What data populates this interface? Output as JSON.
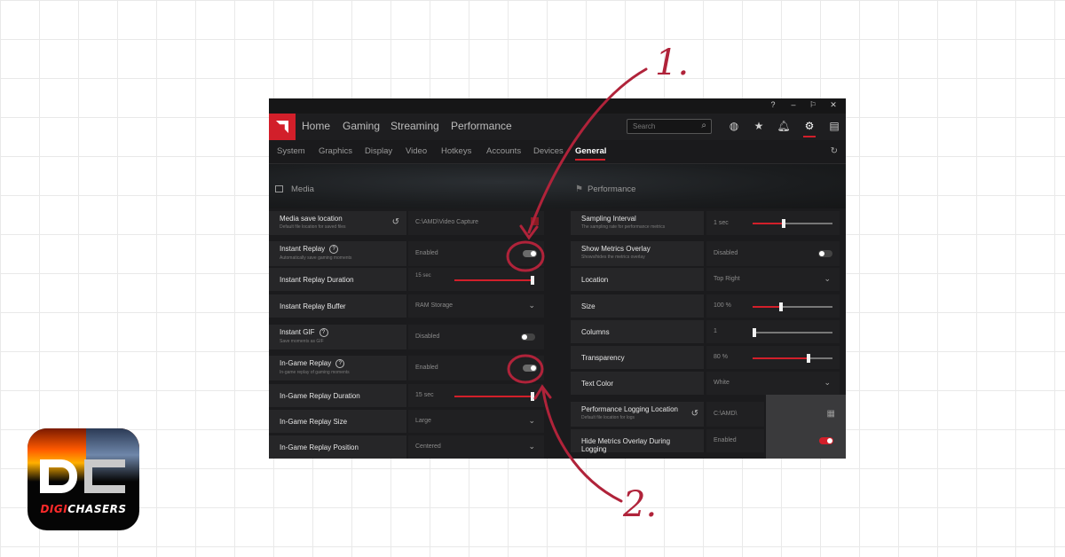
{
  "window": {
    "controls": [
      "?",
      "–",
      "⚐",
      "✕"
    ],
    "nav": [
      "Home",
      "Gaming",
      "Streaming",
      "Performance"
    ],
    "search_placeholder": "Search",
    "icons": [
      "globe-icon",
      "star-icon",
      "bell-icon",
      "gear-icon",
      "layout-icon"
    ],
    "subnav": [
      "System",
      "Graphics",
      "Display",
      "Video",
      "Hotkeys",
      "Accounts",
      "Devices",
      "General"
    ],
    "active_subnav": "General",
    "accent": "#d21f2a"
  },
  "media": {
    "title": "Media",
    "rows": [
      {
        "label": "Media save location",
        "desc": "Default file location for saved files",
        "value": "C:\\AMD\\Video Capture"
      },
      {
        "label": "Instant Replay",
        "desc": "Automatically save gaming moments",
        "value": "Enabled"
      },
      {
        "label": "Instant Replay Duration",
        "value": "15 sec"
      },
      {
        "label": "Instant Replay Buffer",
        "value": "RAM Storage"
      },
      {
        "label": "Instant GIF",
        "desc": "Save moments as GIF",
        "value": "Disabled"
      },
      {
        "label": "In-Game Replay",
        "desc": "In-game replay of gaming moments",
        "value": "Enabled"
      },
      {
        "label": "In-Game Replay Duration",
        "value": "15 sec"
      },
      {
        "label": "In-Game Replay Size",
        "value": "Large"
      },
      {
        "label": "In-Game Replay Position",
        "value": "Centered"
      }
    ]
  },
  "performance": {
    "title": "Performance",
    "rows": [
      {
        "label": "Sampling Interval",
        "desc": "The sampling rate for performance metrics",
        "value": "1 sec"
      },
      {
        "label": "Show Metrics Overlay",
        "desc": "Shows/hides the metrics overlay",
        "value": "Disabled"
      },
      {
        "label": "Location",
        "value": "Top Right"
      },
      {
        "label": "Size",
        "value": "100 %"
      },
      {
        "label": "Columns",
        "value": "1"
      },
      {
        "label": "Transparency",
        "value": "80 %"
      },
      {
        "label": "Text Color",
        "value": "White"
      },
      {
        "label": "Performance Logging Location",
        "desc": "Default file location for logs",
        "value": "C:\\AMD\\"
      },
      {
        "label": "Hide Metrics Overlay During Logging",
        "value": "Enabled"
      }
    ]
  },
  "annotations": [
    "1.",
    "2."
  ],
  "badge": {
    "brand": "DIGI CHASERS",
    "part1": "DIGI",
    "part2": "CHASERS"
  }
}
